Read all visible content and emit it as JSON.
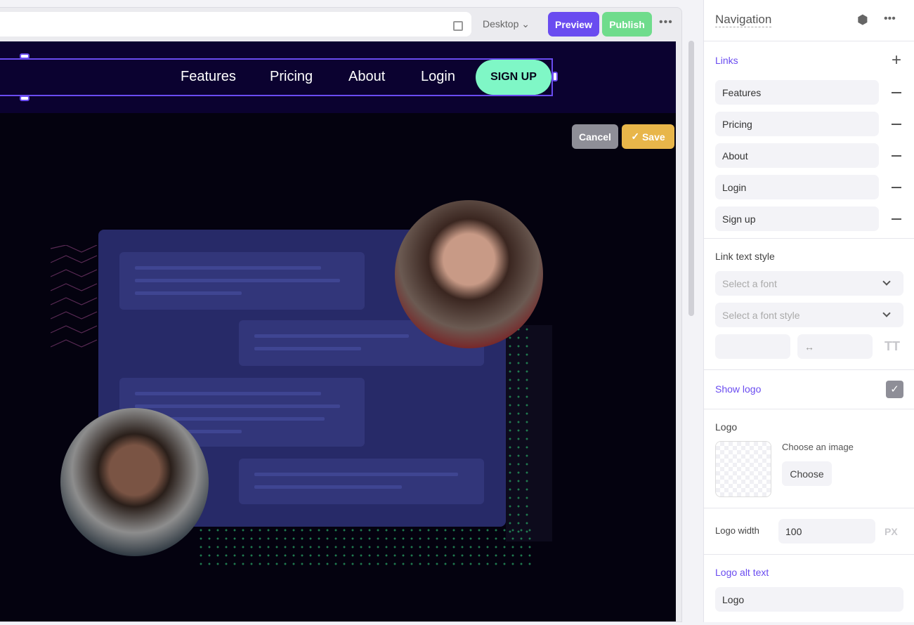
{
  "toolbar": {
    "device": "Desktop",
    "preview": "Preview",
    "publish": "Publish",
    "more": "•••"
  },
  "canvas": {
    "nav_links": [
      "Features",
      "Pricing",
      "About",
      "Login"
    ],
    "signup": "SIGN UP",
    "cancel": "Cancel",
    "save": "Save"
  },
  "panel": {
    "title": "Navigation",
    "links_label": "Links",
    "links": [
      "Features",
      "Pricing",
      "About",
      "Login",
      "Sign up"
    ],
    "link_text_style": "Link text style",
    "font_placeholder": "Select a font",
    "font_style_placeholder": "Select a font style",
    "tt": "TT",
    "show_logo": "Show logo",
    "show_logo_checked": true,
    "logo": "Logo",
    "choose_image": "Choose an image",
    "choose": "Choose",
    "logo_width_label": "Logo width",
    "logo_width": "100",
    "px": "PX",
    "logo_alt_label": "Logo alt text",
    "logo_alt": "Logo"
  },
  "colors": {
    "accent": "#6a4cf0",
    "publish": "#6fdc8c",
    "signup": "#7ff7c6",
    "save": "#e8b64a",
    "cancel": "#8e8e97"
  }
}
